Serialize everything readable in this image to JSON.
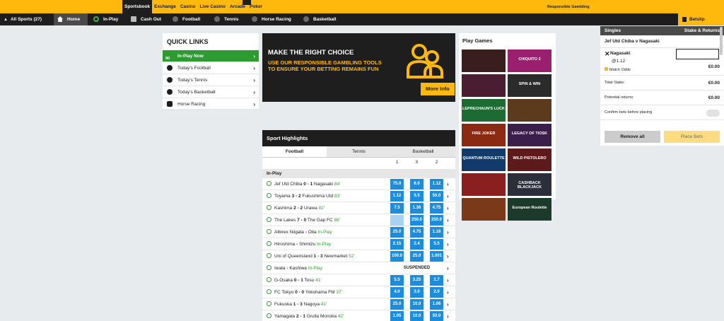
{
  "top_tabs": [
    "Sportsbook",
    "Exchange",
    "Casino",
    "Live Casino",
    "Arcade",
    "Poker"
  ],
  "responsible_gambling": "Responsible Gambling",
  "nav": {
    "all_sports": "All Sports (27)",
    "home": "Home",
    "in_play": "In-Play",
    "cash_out": "Cash Out",
    "football": "Football",
    "tennis": "Tennis",
    "horse_racing": "Horse Racing",
    "basketball": "Basketball",
    "betslip": "Betslip"
  },
  "quick_links": {
    "title": "QUICK LINKS",
    "items": [
      {
        "label": "In-Play Now",
        "badge": "90"
      },
      {
        "label": "Today's Football"
      },
      {
        "label": "Today's Tennis"
      },
      {
        "label": "Today's Basketball"
      },
      {
        "label": "Horse Racing"
      }
    ]
  },
  "promo": {
    "heading": "MAKE THE RIGHT CHOICE",
    "subtext": "USE OUR RESPONSIBLE GAMBLING TOOLS TO ENSURE YOUR BETTING REMAINS FUN",
    "button": "More Info"
  },
  "highlights": {
    "title": "Sport Highlights",
    "tabs": [
      "Football",
      "Tennis",
      "Basketball"
    ],
    "cols": [
      "1",
      "X",
      "2"
    ],
    "section": "In-Play",
    "rows": [
      {
        "home": "Jef Utd Chiba",
        "score": "0 - 1",
        "away": "Nagasaki",
        "time": "84'",
        "odds": [
          "75.0",
          "6.0",
          "1.12"
        ]
      },
      {
        "home": "Toyama",
        "score": "3 - 2",
        "away": "Fukushima Utd",
        "time": "83'",
        "odds": [
          "1.12",
          "5.5",
          "50.0"
        ]
      },
      {
        "home": "Kashima",
        "score": "2 - 2",
        "away": "Urawa",
        "time": "82'",
        "odds": [
          "7.5",
          "1.36",
          "4.75"
        ]
      },
      {
        "home": "The Lakes",
        "score": "7 - 0",
        "away": "The Gap FC",
        "time": "88'",
        "odds": [
          "",
          "250.0",
          "250.0"
        ]
      },
      {
        "home": "Albirex Niigata",
        "score": " - ",
        "away": "Oita",
        "time": "In-Play",
        "odds": [
          "25.0",
          "4.75",
          "1.18"
        ]
      },
      {
        "home": "Hiroshima",
        "score": " - ",
        "away": "Shimizu",
        "time": "In-Play",
        "odds": [
          "2.15",
          "2.4",
          "5.5"
        ]
      },
      {
        "home": "Uni of Queensland",
        "score": "1 - 3",
        "away": "Newmarket",
        "time": "52'",
        "odds": [
          "100.0",
          "25.0",
          "1.001"
        ]
      },
      {
        "home": "Iwata",
        "score": " - ",
        "away": "Kashiwa",
        "time": "In-Play",
        "suspended": "SUSPENDED"
      },
      {
        "home": "G-Osaka",
        "score": "0 - 1",
        "away": "Tosu",
        "time": "41'",
        "odds": [
          "5.5",
          "3.25",
          "1.7"
        ]
      },
      {
        "home": "FC Tokyo",
        "score": "0 - 0",
        "away": "Yokohama FM",
        "time": "37'",
        "odds": [
          "4.0",
          "3.0",
          "2.0"
        ]
      },
      {
        "home": "Fukuoka",
        "score": "1 - 3",
        "away": "Nagoya",
        "time": "41'",
        "odds": [
          "25.0",
          "10.0",
          "1.06"
        ]
      },
      {
        "home": "Yamagata",
        "score": "2 - 1",
        "away": "Grulla Morioka",
        "time": "42'",
        "odds": [
          "1.05",
          "10.0",
          "50.0"
        ]
      }
    ]
  },
  "games": {
    "title": "Play Games",
    "tiles": [
      {
        "label": "",
        "color": "#3a1d1d"
      },
      {
        "label": "CHIQUITO 2",
        "color": "#9a1f6e"
      },
      {
        "label": "",
        "color": "#4a1d32"
      },
      {
        "label": "SPIN & WIN",
        "color": "#2b2b2b"
      },
      {
        "label": "LEPRECHAUN'S LUCK",
        "color": "#1d6b32"
      },
      {
        "label": "",
        "color": "#5c3b1c"
      },
      {
        "label": "FIRE JOKER",
        "color": "#8a2a12"
      },
      {
        "label": "LEGACY OF TIOSK",
        "color": "#3c1e4a"
      },
      {
        "label": "QUANTUM ROULETTE",
        "color": "#123a6b"
      },
      {
        "label": "WILD PISTOLERO",
        "color": "#5e1a1a"
      },
      {
        "label": "",
        "color": "#8a1f1f"
      },
      {
        "label": "CASHBACK BLACKJACK",
        "color": "#2b2f3a"
      },
      {
        "label": "",
        "color": "#7a3a1a"
      },
      {
        "label": "European Roulette",
        "color": "#1b3a2a"
      }
    ]
  },
  "betslip": {
    "singles": "Singles",
    "stake_returns": "Stake & Returns",
    "match": "Jef Utd Chiba v Nagasaki",
    "selection": "Nagasaki",
    "price": "@1.12",
    "market": "Match Odds",
    "amount": "€0.00",
    "total_stake_label": "Total Stake:",
    "total_stake": "€0.00",
    "potential_label": "Potential returns:",
    "potential": "€0.00",
    "confirm_label": "Confirm bets before placing",
    "remove_all": "Remove all",
    "place_bets": "Place Bets"
  }
}
